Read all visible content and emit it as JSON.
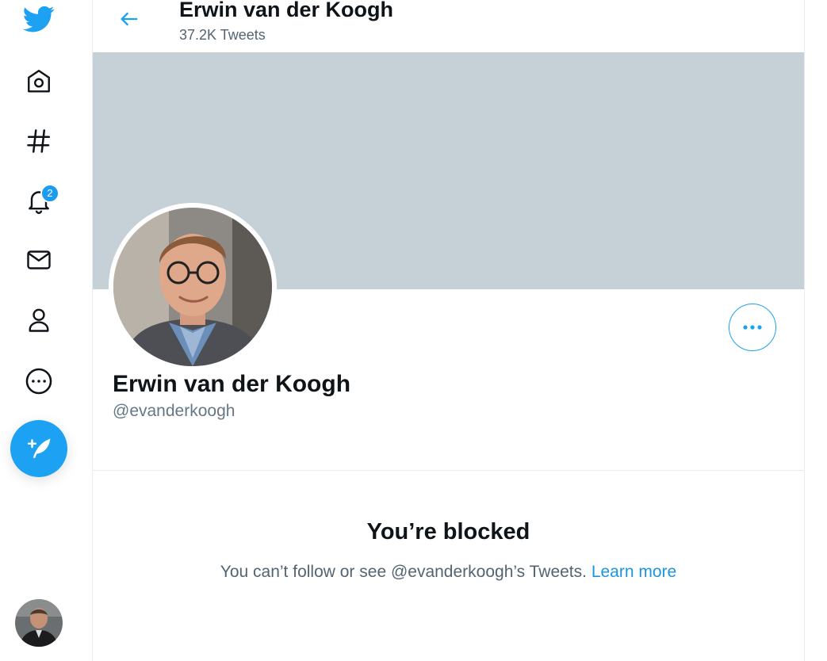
{
  "colors": {
    "accent": "#1da1f2",
    "banner": "#c5d0d7",
    "text": "#0f1419",
    "secondary": "#536471"
  },
  "nav": {
    "items": [
      {
        "name": "twitter-logo",
        "icon": "twitter-bird-icon"
      },
      {
        "name": "home",
        "icon": "home-icon"
      },
      {
        "name": "explore",
        "icon": "hashtag-icon"
      },
      {
        "name": "notifications",
        "icon": "bell-icon",
        "badge": "2"
      },
      {
        "name": "messages",
        "icon": "envelope-icon"
      },
      {
        "name": "profile",
        "icon": "person-icon"
      },
      {
        "name": "more",
        "icon": "more-circle-icon"
      }
    ],
    "compose_icon": "compose-feather-icon"
  },
  "header": {
    "title": "Erwin van der Koogh",
    "tweet_count": "37.2K Tweets",
    "back_icon": "arrow-left-icon"
  },
  "profile": {
    "name": "Erwin van der Koogh",
    "handle": "@evanderkoogh",
    "more_icon": "more-horizontal-icon"
  },
  "blocked": {
    "title": "You’re blocked",
    "message": "You can’t follow or see @evanderkoogh’s Tweets.",
    "link": "Learn more"
  }
}
